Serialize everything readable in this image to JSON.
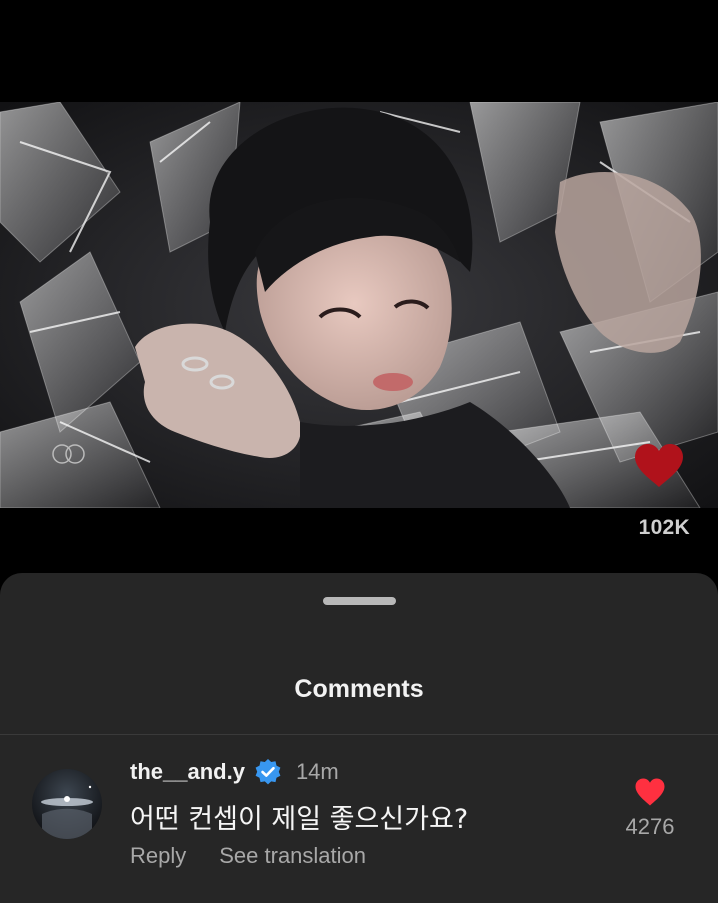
{
  "media": {
    "like_count": "102K",
    "like_color": "#b0121b"
  },
  "sheet": {
    "title": "Comments"
  },
  "comment": {
    "username": "the__and.y",
    "verified": true,
    "time": "14m",
    "text": "어떤 컨셉이 제일 좋으신가요?",
    "reply_label": "Reply",
    "translate_label": "See translation",
    "like_count": "4276",
    "like_color": "#ff3040"
  },
  "colors": {
    "sheet_bg": "#262626",
    "verified_blue": "#3897f0",
    "secondary_text": "#a8a8a8"
  },
  "icons": {
    "media_like": "heart-icon",
    "verified": "verified-badge-icon",
    "comment_like": "heart-icon"
  }
}
